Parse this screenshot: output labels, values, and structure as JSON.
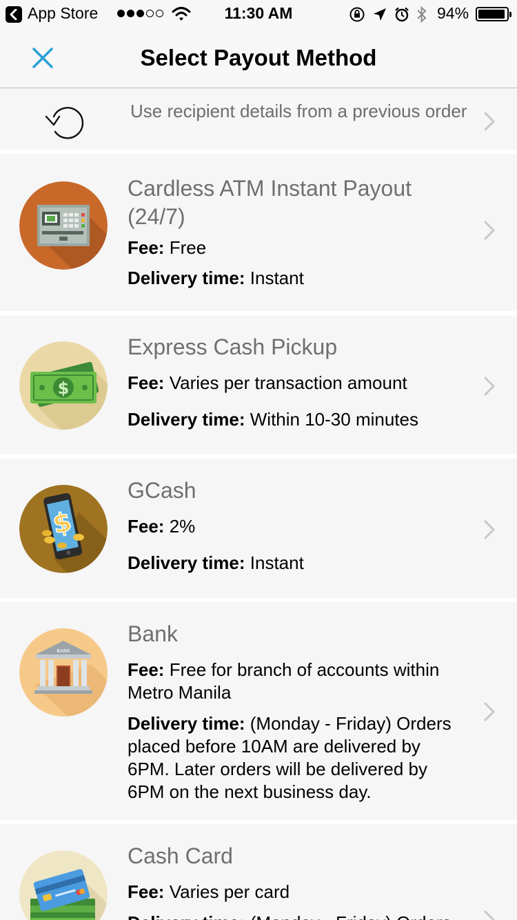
{
  "status_bar": {
    "carrier": "App Store",
    "time": "11:30 AM",
    "battery": "94%",
    "battery_level": 0.94,
    "signal_bars_filled": 3,
    "signal_bars_total": 5
  },
  "nav": {
    "title": "Select Payout Method",
    "close_icon": "close-icon"
  },
  "previous_order": {
    "text": "Use recipient details from a previous order",
    "icon": "history-icon"
  },
  "fee_label": "Fee:",
  "delivery_label": "Delivery time:",
  "methods": [
    {
      "title": "Cardless ATM Instant Payout (24/7)",
      "fee": "Free",
      "delivery": "Instant",
      "icon": "atm-icon",
      "icon_color": "#c8692a"
    },
    {
      "title": "Express Cash Pickup",
      "fee": "Varies per transaction amount",
      "delivery": "Within 10-30 minutes",
      "icon": "cash-icon",
      "icon_color": "#ead9a7"
    },
    {
      "title": "GCash",
      "fee": "2%",
      "delivery": "Instant",
      "icon": "mobile-wallet-icon",
      "icon_color": "#9f7322"
    },
    {
      "title": "Bank",
      "fee": "Free for branch of accounts within Metro Manila",
      "delivery": "(Monday - Friday) Orders placed before 10AM are delivered by 6PM. Later orders will be delivered by 6PM on the next business day.",
      "icon": "bank-icon",
      "icon_color": "#f6c989",
      "bank_sign": "BANK"
    },
    {
      "title": "Cash Card",
      "fee": "Varies per card",
      "delivery": "(Monday - Friday) Orders",
      "icon": "cash-card-icon",
      "icon_color": "#efe6c6"
    }
  ]
}
